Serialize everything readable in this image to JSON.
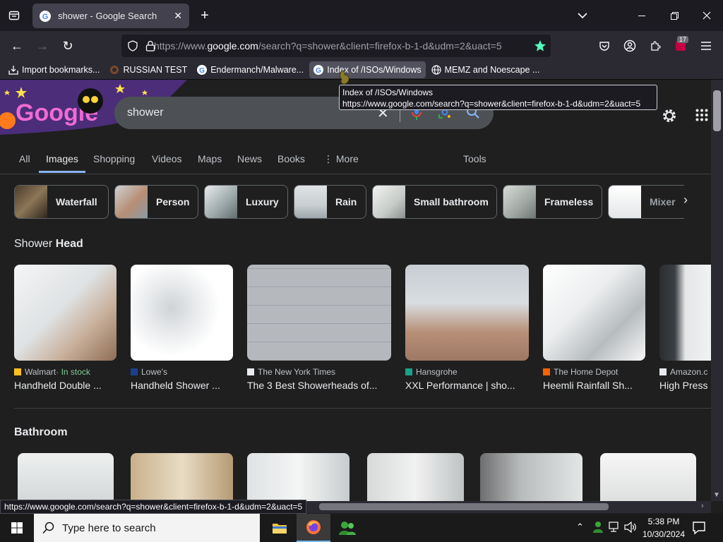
{
  "browser": {
    "tab_title": "shower - Google Search",
    "url_prefix": "https://www.",
    "url_domain": "google.com",
    "url_rest": "/search?q=shower&client=firefox-b-1-d&udm=2&uact=5",
    "notification_count": "17"
  },
  "bookmarks": [
    {
      "label": "Import bookmarks..."
    },
    {
      "label": "RUSSIAN TEST"
    },
    {
      "label": "Endermanch/Malware..."
    },
    {
      "label": "Index of /ISOs/Windows"
    },
    {
      "label": "MEMZ and Noescape ..."
    }
  ],
  "tooltip": {
    "title": "Index of /ISOs/Windows",
    "url": "https://www.google.com/search?q=shower&client=firefox-b-1-d&udm=2&uact=5"
  },
  "search": {
    "query": "shower"
  },
  "google_tabs": {
    "all": "All",
    "images": "Images",
    "shopping": "Shopping",
    "videos": "Videos",
    "maps": "Maps",
    "news": "News",
    "books": "Books",
    "more": "More",
    "tools": "Tools"
  },
  "chips": [
    {
      "label": "Waterfall"
    },
    {
      "label": "Person"
    },
    {
      "label": "Luxury"
    },
    {
      "label": "Rain"
    },
    {
      "label": "Small bathroom"
    },
    {
      "label": "Frameless"
    },
    {
      "label": "Mixer"
    }
  ],
  "sections": {
    "shower_head_normal": "Shower ",
    "shower_head_bold": "Head",
    "bathroom": "Bathroom"
  },
  "results": [
    {
      "source": "Walmart",
      "stock": " · In stock",
      "title": "Handheld Double ..."
    },
    {
      "source": "Lowe's",
      "stock": "",
      "title": "Handheld Shower ..."
    },
    {
      "source": "The New York Times",
      "stock": "",
      "title": "The 3 Best Showerheads of..."
    },
    {
      "source": "Hansgrohe",
      "stock": "",
      "title": "XXL Performance | sho..."
    },
    {
      "source": "The Home Depot",
      "stock": "",
      "title": "Heemli Rainfall Sh..."
    },
    {
      "source": "Amazon.c",
      "stock": "",
      "title": "High Press"
    }
  ],
  "status_url": "https://www.google.com/search?q=shower&client=firefox-b-1-d&udm=2&uact=5",
  "taskbar": {
    "search_placeholder": "Type here to search",
    "time": "5:38 PM",
    "date": "10/30/2024"
  },
  "colors": {
    "accent": "#8ab4f8",
    "in_stock": "#81c995",
    "bookmark_star": "#54ffbd"
  }
}
